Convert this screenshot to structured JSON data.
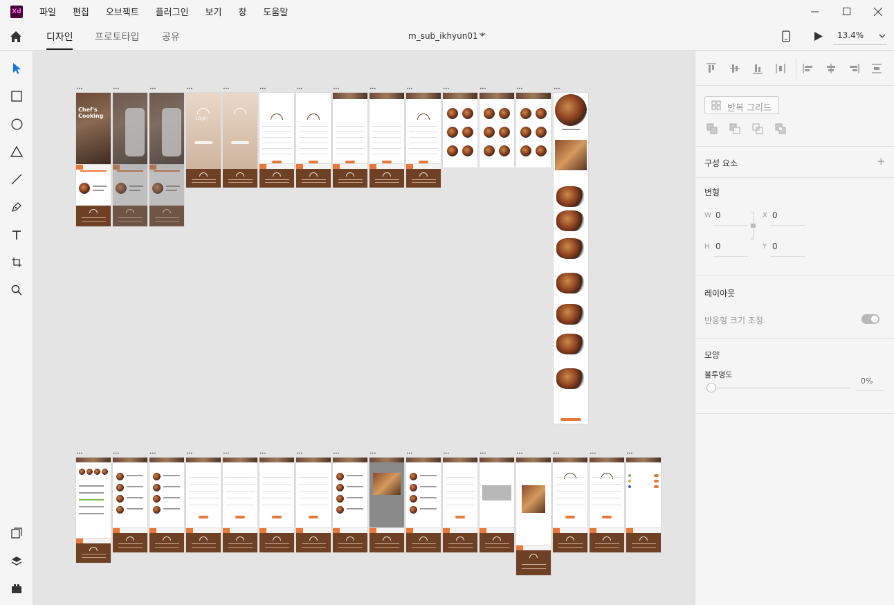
{
  "titlebar": {
    "app_badge": "Xd",
    "menu": [
      "파일",
      "편집",
      "오브젝트",
      "플러그인",
      "보기",
      "창",
      "도움말"
    ]
  },
  "toolbar": {
    "tabs": [
      "디자인",
      "프로토타입",
      "공유"
    ],
    "document_title": "m_sub_ikhyun01 *",
    "zoom": "13.4%"
  },
  "canvas": {
    "artboard_label": "•••",
    "hero_title": "Chef's Cooking",
    "login_title": "LOgin"
  },
  "panel": {
    "repeat_grid": "반복 그리드",
    "components": "구성 요소",
    "transform": "변형",
    "w_label": "W",
    "w_value": "0",
    "x_label": "X",
    "x_value": "0",
    "h_label": "H",
    "h_value": "0",
    "y_label": "Y",
    "y_value": "0",
    "layout": "레이아웃",
    "responsive_resize": "반응형 크기 조정",
    "appearance": "모양",
    "opacity": "불투명도",
    "opacity_value": "0%"
  },
  "colors": {
    "accent_orange": "#e8783a",
    "footer_brown": "#6e4125",
    "xd_badge": "#470137"
  }
}
